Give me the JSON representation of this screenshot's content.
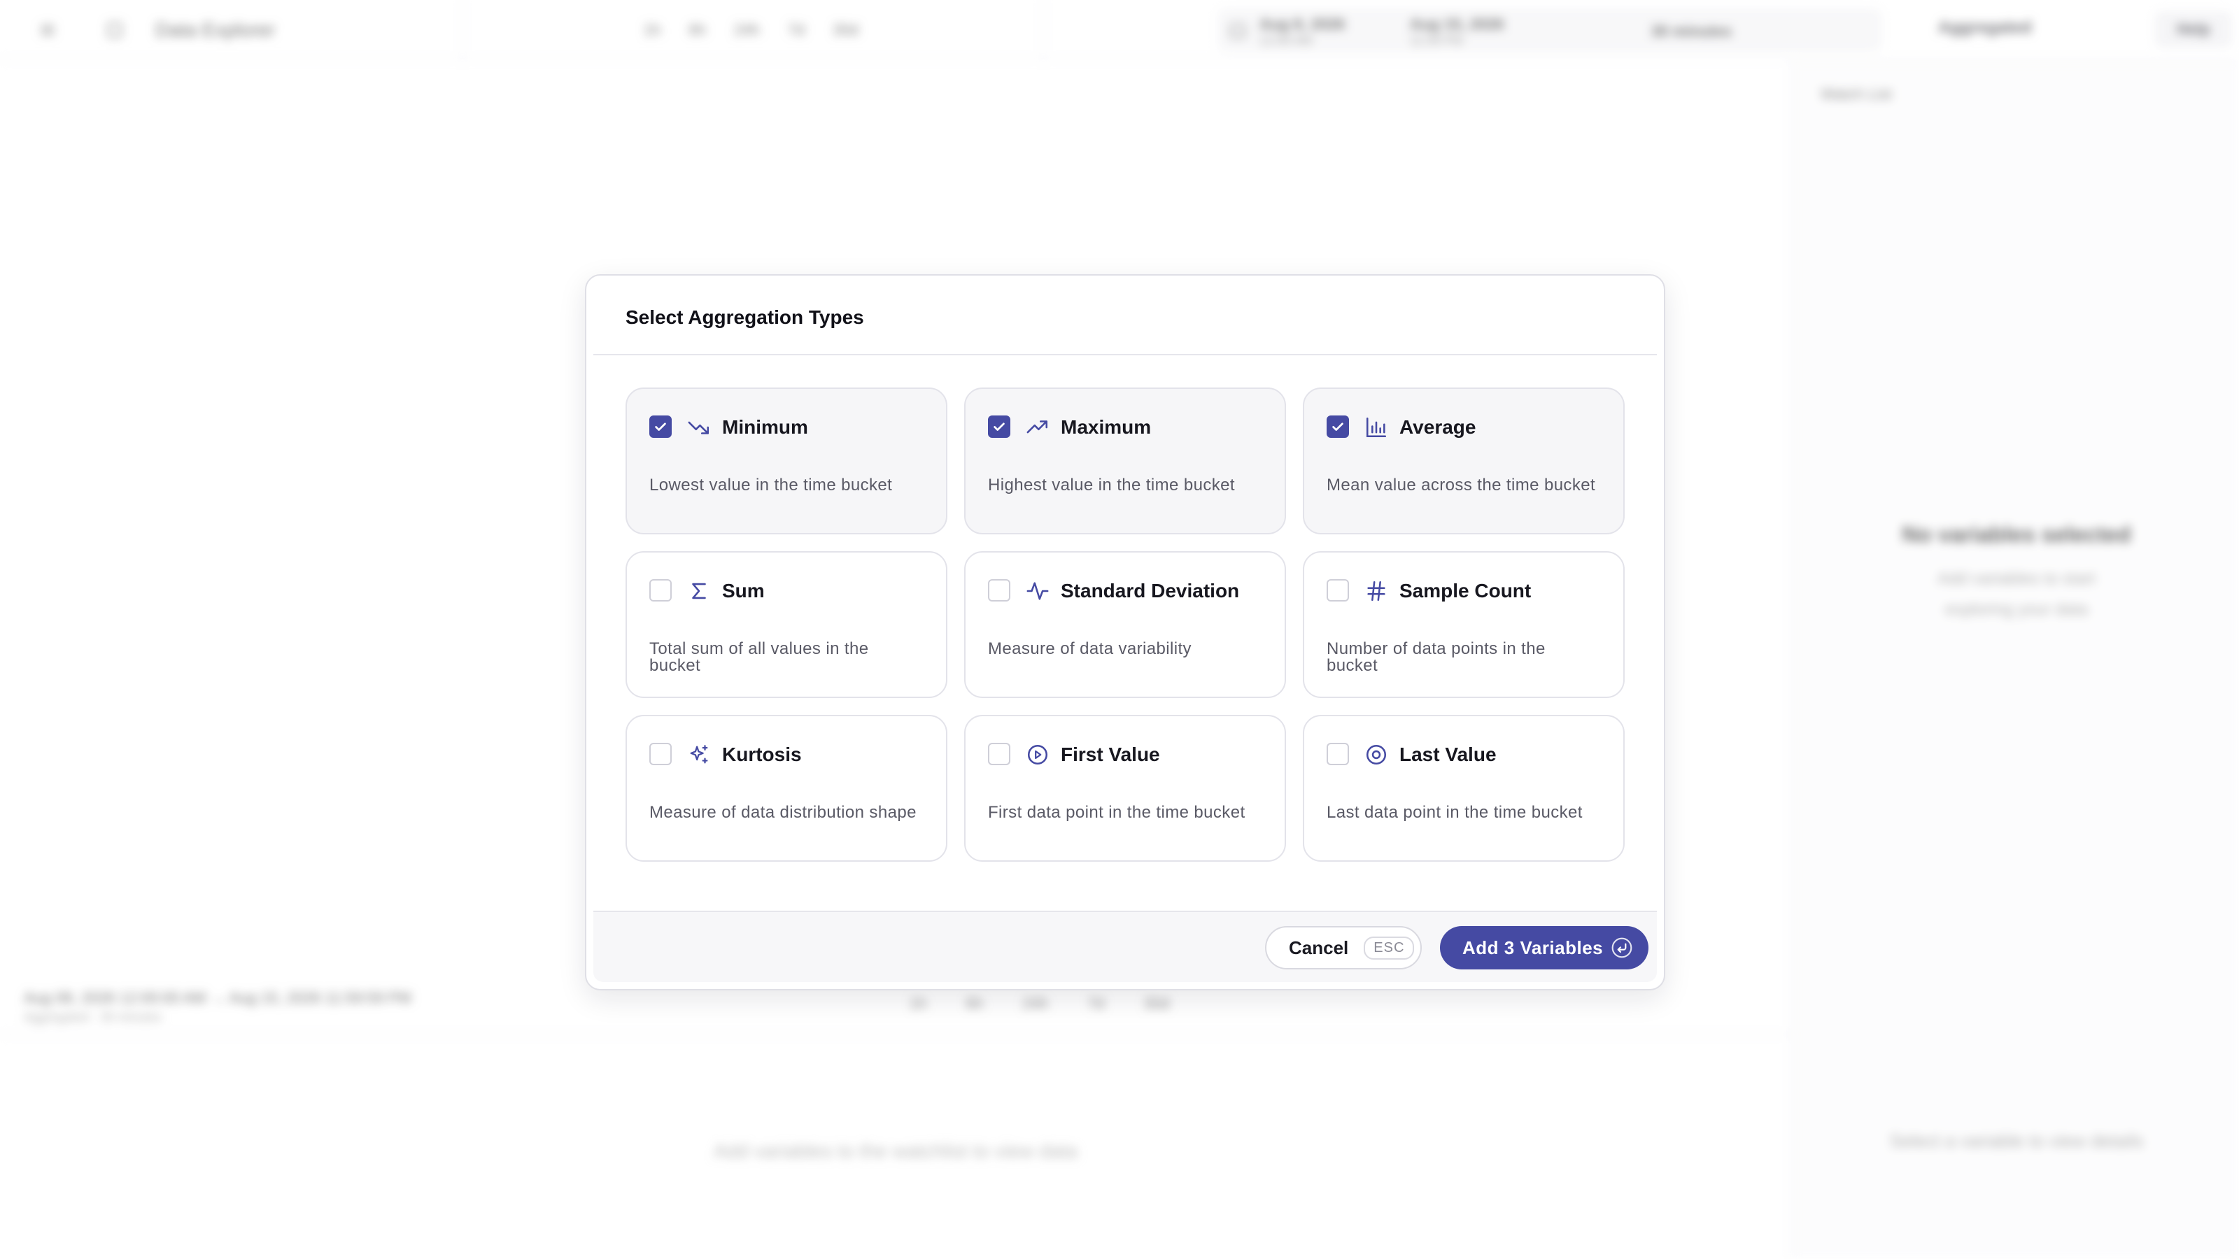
{
  "app": {
    "title": "Data Explorer",
    "quick_ranges": [
      "1h",
      "6h",
      "24h",
      "7d",
      "30d"
    ],
    "range": {
      "start_date": "Aug 8, 2026",
      "start_time": "12:00 AM",
      "end_date": "Aug 15, 2026",
      "end_time": "11:59 PM",
      "interval": "30 minutes"
    },
    "mode_label": "Aggregated",
    "help_label": "Help",
    "right_panel": {
      "header": "Watch List",
      "empty_title": "No variables selected",
      "empty_subtitle": "Add variables to start exploring your data",
      "bottom_hint": "Select a variable to view details"
    },
    "timeline": {
      "range_text": "Aug 08, 2026 12:00:00 AM → Aug 15, 2026 11:59:59 PM",
      "sub_text": "Aggregated · 30 minutes"
    },
    "main_empty": "Add variables to the watchlist to view data"
  },
  "modal": {
    "title": "Select Aggregation Types",
    "options": [
      {
        "label": "Minimum",
        "description": "Lowest value in the time bucket",
        "icon": "trending-down-icon",
        "checked": true
      },
      {
        "label": "Maximum",
        "description": "Highest value in the time bucket",
        "icon": "trending-up-icon",
        "checked": true
      },
      {
        "label": "Average",
        "description": "Mean value across the time bucket",
        "icon": "bar-chart-icon",
        "checked": true
      },
      {
        "label": "Sum",
        "description": "Total sum of all values in the bucket",
        "icon": "sigma-icon",
        "checked": false
      },
      {
        "label": "Standard Deviation",
        "description": "Measure of data variability",
        "icon": "activity-icon",
        "checked": false
      },
      {
        "label": "Sample Count",
        "description": "Number of data points in the bucket",
        "icon": "hash-icon",
        "checked": false
      },
      {
        "label": "Kurtosis",
        "description": "Measure of data distribution shape",
        "icon": "sparkles-icon",
        "checked": false
      },
      {
        "label": "First Value",
        "description": "First data point in the time bucket",
        "icon": "play-circle-icon",
        "checked": false
      },
      {
        "label": "Last Value",
        "description": "Last data point in the time bucket",
        "icon": "target-icon",
        "checked": false
      }
    ],
    "cancel_label": "Cancel",
    "cancel_shortcut": "ESC",
    "submit_label": "Add 3 Variables",
    "accent_color": "#454aa3"
  }
}
